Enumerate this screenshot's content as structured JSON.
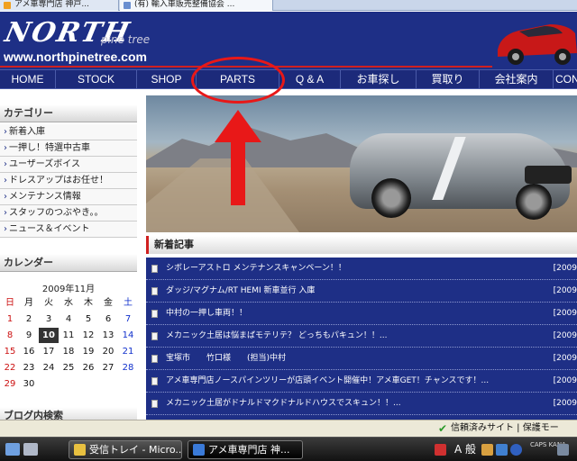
{
  "browser": {
    "tabs": [
      {
        "label": "アメ車専門店 神戸..."
      },
      {
        "label": "(有) 輸入車販売整備協会 ..."
      }
    ]
  },
  "header": {
    "logo": "NORTH",
    "logo_sub": "pine tree",
    "url": "www.northpinetree.com"
  },
  "nav": {
    "items": [
      "HOME",
      "STOCK",
      "SHOP",
      "PARTS",
      "Q & A",
      "お車探し",
      "買取り",
      "会社案内",
      "CON"
    ]
  },
  "sidebar": {
    "category_title": "カテゴリー",
    "categories": [
      "新着入庫",
      "一押し！特選中古車",
      "ユーザーズボイス",
      "ドレスアップはお任せ！",
      "メンテナンス情報",
      "スタッフのつぶやき。。",
      "ニュース＆イベント"
    ],
    "calendar_title": "カレンダー",
    "calendar_month": "2009年11月",
    "weekdays": [
      "日",
      "月",
      "火",
      "水",
      "木",
      "金",
      "土"
    ],
    "weeks": [
      [
        "1",
        "2",
        "3",
        "4",
        "5",
        "6",
        "7"
      ],
      [
        "8",
        "9",
        "10",
        "11",
        "12",
        "13",
        "14"
      ],
      [
        "15",
        "16",
        "17",
        "18",
        "19",
        "20",
        "21"
      ],
      [
        "22",
        "23",
        "24",
        "25",
        "26",
        "27",
        "28"
      ],
      [
        "29",
        "30",
        "",
        "",
        "",
        "",
        ""
      ]
    ],
    "today": "10",
    "blog_search_title": "ブログ内検索"
  },
  "main": {
    "news_title": "新着記事",
    "news": [
      {
        "title": "シボレーアストロ メンテナンスキャンペーン！！",
        "date": "[2009"
      },
      {
        "title": "ダッジ/マグナム/RT HEMI 新車並行 入庫",
        "date": "[2009"
      },
      {
        "title": "中村の一押し車両！！",
        "date": "[2009"
      },
      {
        "title": "メカニック土居は悩まばモテリテ？ どっちもパキュン！！...",
        "date": "[2009"
      },
      {
        "title": "宝塚市　　竹口様　　(担当)中村",
        "date": "[2009"
      },
      {
        "title": "アメ車専門店ノースパインツリーが店頭イベント開催中！アメ車GET！チャンスです！...",
        "date": "[2009"
      },
      {
        "title": "メカニック土居がドナルドマクドナルドハウスでスキュン！！...",
        "date": "[2009"
      }
    ]
  },
  "statusbar": {
    "text": "信頼済みサイト | 保護モー"
  },
  "taskbar": {
    "buttons": [
      {
        "label": "受信トレイ - Micro..."
      },
      {
        "label": "アメ車専門店 神..."
      }
    ],
    "ime": "A 般",
    "caps": "CAPS KANA"
  },
  "colors": {
    "navy": "#1e2f86",
    "accent_red": "#e81818"
  }
}
